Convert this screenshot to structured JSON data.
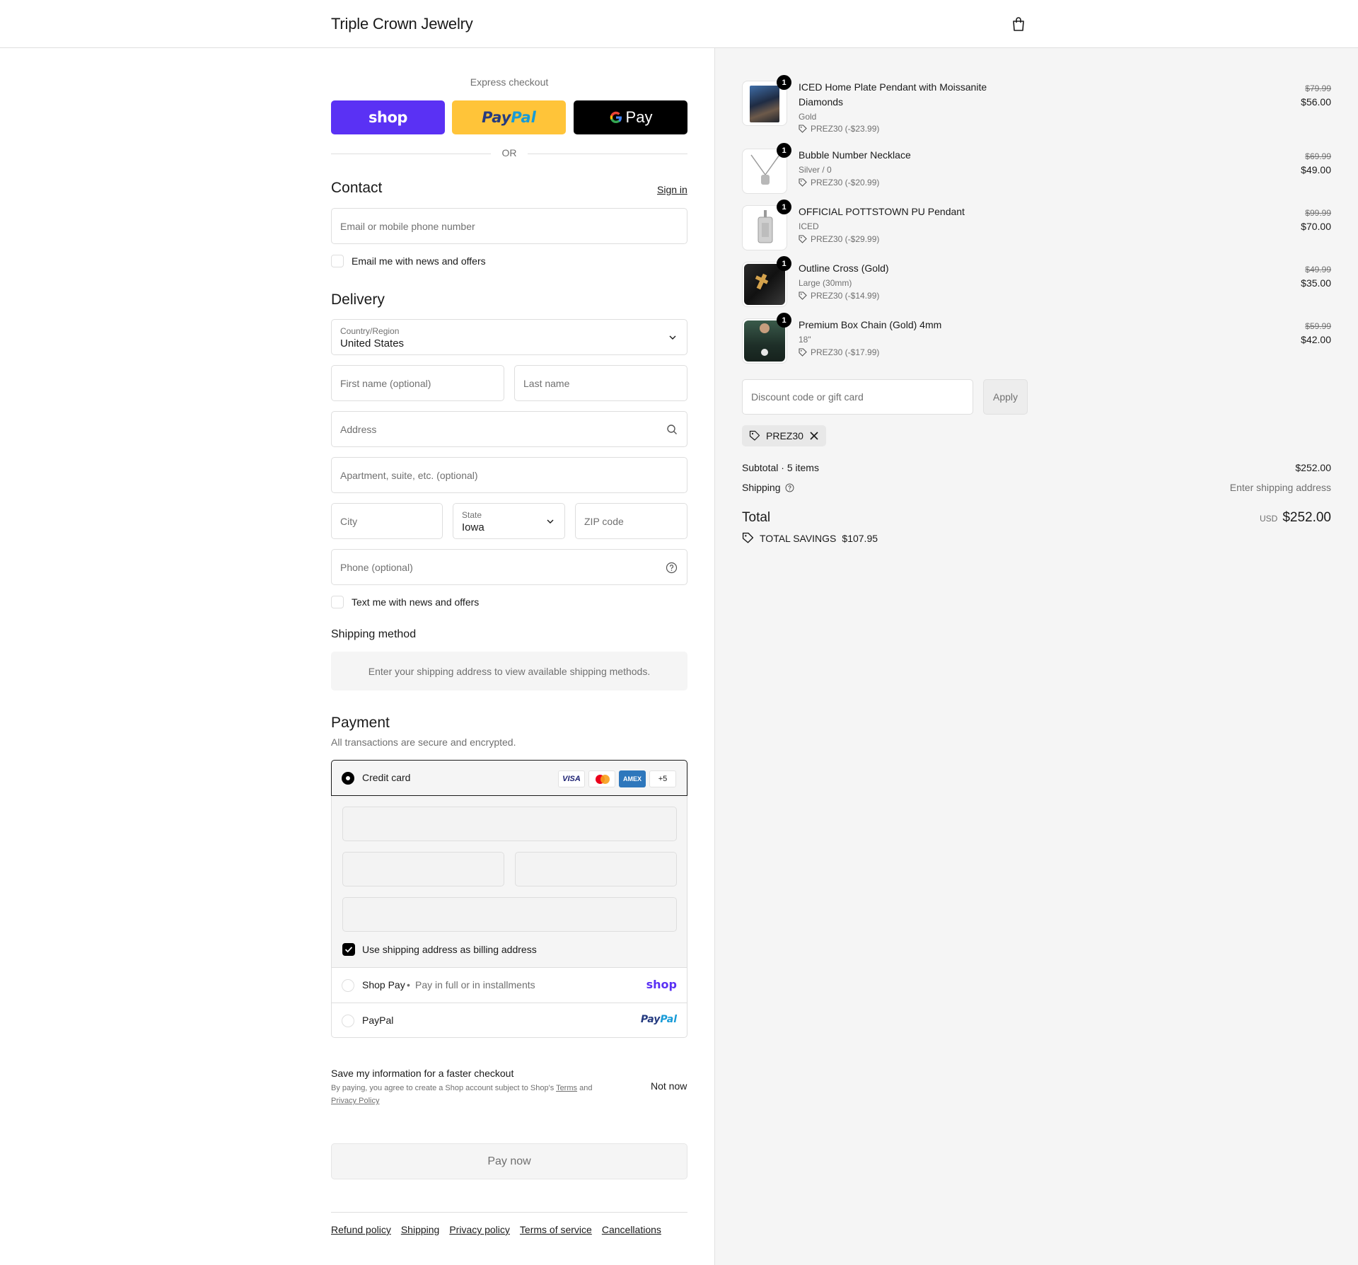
{
  "header": {
    "brand": "Triple Crown Jewelry",
    "cart_icon": "shopping-bag-icon"
  },
  "express": {
    "title": "Express checkout",
    "shop_label": "shop",
    "paypal_label_a": "Pay",
    "paypal_label_b": "Pal",
    "gpay_label": "Pay",
    "or_label": "OR",
    "colors": {
      "shop": "#5a31f4",
      "paypal": "#ffc439",
      "gpay": "#000000"
    }
  },
  "contact": {
    "heading": "Contact",
    "sign_in": "Sign in",
    "email_placeholder": "Email or mobile phone number",
    "news_label": "Email me with news and offers"
  },
  "delivery": {
    "heading": "Delivery",
    "country_label": "Country/Region",
    "country_value": "United States",
    "first_name_placeholder": "First name (optional)",
    "last_name_placeholder": "Last name",
    "address_placeholder": "Address",
    "apt_placeholder": "Apartment, suite, etc. (optional)",
    "city_placeholder": "City",
    "state_label": "State",
    "state_value": "Iowa",
    "zip_placeholder": "ZIP code",
    "phone_placeholder": "Phone (optional)",
    "text_label": "Text me with news and offers"
  },
  "shipping_method": {
    "heading": "Shipping method",
    "message": "Enter your shipping address to view available shipping methods."
  },
  "payment": {
    "heading": "Payment",
    "subtext": "All transactions are secure and encrypted.",
    "credit_card_label": "Credit card",
    "card_brands": [
      "VISA",
      "MC",
      "AMEX"
    ],
    "more_brands": "+5",
    "billing_label": "Use shipping address as billing address",
    "shop_pay_label": "Shop Pay",
    "shop_pay_sub": "Pay in full or in installments",
    "shop_pay_logo": "shop",
    "paypal_label": "PayPal",
    "paypal_logo_a": "Pay",
    "paypal_logo_b": "Pal"
  },
  "save_info": {
    "title": "Save my information for a faster checkout",
    "text_a": "By paying, you agree to create a Shop account subject to Shop's",
    "terms": "Terms",
    "and": "and",
    "privacy": "Privacy Policy",
    "not_now": "Not now"
  },
  "pay_now": "Pay now",
  "footer": [
    "Refund policy",
    "Shipping",
    "Privacy policy",
    "Terms of service",
    "Cancellations"
  ],
  "items": [
    {
      "qty": "1",
      "title": "ICED Home Plate Pendant with Moissanite Diamonds",
      "variant": "Gold",
      "discount": "PREZ30 (-$23.99)",
      "old": "$79.99",
      "price": "$56.00"
    },
    {
      "qty": "1",
      "title": "Bubble Number Necklace",
      "variant": "Silver / 0",
      "discount": "PREZ30 (-$20.99)",
      "old": "$69.99",
      "price": "$49.00"
    },
    {
      "qty": "1",
      "title": "OFFICIAL POTTSTOWN PU Pendant",
      "variant": "ICED",
      "discount": "PREZ30 (-$29.99)",
      "old": "$99.99",
      "price": "$70.00"
    },
    {
      "qty": "1",
      "title": "Outline Cross (Gold)",
      "variant": "Large (30mm)",
      "discount": "PREZ30 (-$14.99)",
      "old": "$49.99",
      "price": "$35.00"
    },
    {
      "qty": "1",
      "title": "Premium Box Chain (Gold) 4mm",
      "variant": "18\"",
      "discount": "PREZ30 (-$17.99)",
      "old": "$59.99",
      "price": "$42.00"
    }
  ],
  "summary": {
    "discount_placeholder": "Discount code or gift card",
    "apply": "Apply",
    "code_chip": "PREZ30",
    "subtotal_label": "Subtotal · 5 items",
    "subtotal_value": "$252.00",
    "shipping_label": "Shipping",
    "shipping_value": "Enter shipping address",
    "total_label": "Total",
    "currency": "USD",
    "total_value": "$252.00",
    "savings_label": "TOTAL SAVINGS",
    "savings_value": "$107.95"
  }
}
